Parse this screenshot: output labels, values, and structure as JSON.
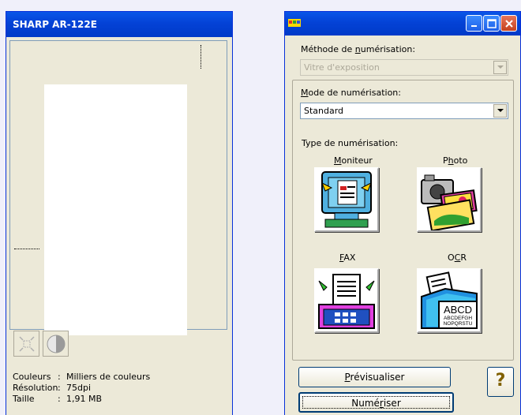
{
  "left_window": {
    "title": "SHARP AR-122E",
    "info": [
      {
        "label": "Couleurs",
        "sep": ":",
        "value": "Milliers de couleurs"
      },
      {
        "label": "Résolution",
        "sep": ":",
        "value": "75dpi"
      },
      {
        "label": "Taille",
        "sep": ":",
        "value": "1,91 MB"
      }
    ]
  },
  "right_window": {
    "scan_method_label_prefix": "Méthode de ",
    "scan_method_label_accel": "n",
    "scan_method_label_suffix": "umérisation:",
    "scan_method_value": "Vitre d'exposition",
    "scan_mode_label_accel": "M",
    "scan_mode_label_suffix": "ode de numérisation:",
    "scan_mode_value": "Standard",
    "scan_type_label": "Type de numérisation:",
    "types": {
      "monitor_accel": "M",
      "monitor_rest": "oniteur",
      "photo_pre": "P",
      "photo_accel": "h",
      "photo_rest": "oto",
      "fax_accel": "F",
      "fax_rest": "AX",
      "ocr_pre": "O",
      "ocr_accel": "C",
      "ocr_rest": "R",
      "ocr_icon_text_1": "ABCD",
      "ocr_icon_text_2": "ABCDEFGH",
      "ocr_icon_text_3": "NOPQRSTU"
    },
    "preview_accel": "P",
    "preview_rest": "révisualiser",
    "scan_pre": "Numé",
    "scan_accel": "r",
    "scan_rest": "iser",
    "help_symbol": "?"
  }
}
